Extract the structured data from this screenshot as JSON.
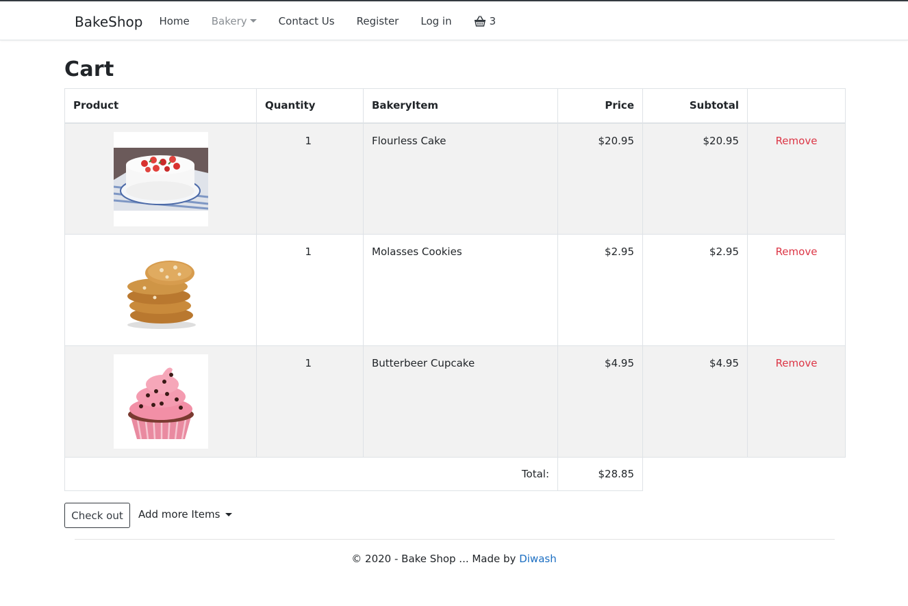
{
  "nav": {
    "brand": "BakeShop",
    "home": "Home",
    "bakery": "Bakery",
    "contact": "Contact Us",
    "register": "Register",
    "login": "Log in",
    "cart_count": "3",
    "cart_icon": "basket-icon"
  },
  "page": {
    "title": "Cart"
  },
  "table": {
    "headers": {
      "product": "Product",
      "quantity": "Quantity",
      "bakery_item": "BakeryItem",
      "price": "Price",
      "subtotal": "Subtotal"
    },
    "rows": [
      {
        "quantity": "1",
        "name": "Flourless Cake",
        "price": "$20.95",
        "subtotal": "$20.95",
        "action": "Remove",
        "image": "strawberry-cake-image"
      },
      {
        "quantity": "1",
        "name": "Molasses Cookies",
        "price": "$2.95",
        "subtotal": "$2.95",
        "action": "Remove",
        "image": "cookies-stack-image"
      },
      {
        "quantity": "1",
        "name": "Butterbeer Cupcake",
        "price": "$4.95",
        "subtotal": "$4.95",
        "action": "Remove",
        "image": "pink-cupcake-image"
      }
    ],
    "total_label": "Total:",
    "total_value": "$28.85"
  },
  "actions": {
    "checkout": "Check out",
    "add_more": "Add more Items"
  },
  "footer": {
    "text": "© 2020 - Bake Shop ... Made by ",
    "author": "Diwash"
  },
  "colors": {
    "remove": "#dc3545",
    "link": "#1b6ec2",
    "stripe": "#f2f2f2"
  }
}
